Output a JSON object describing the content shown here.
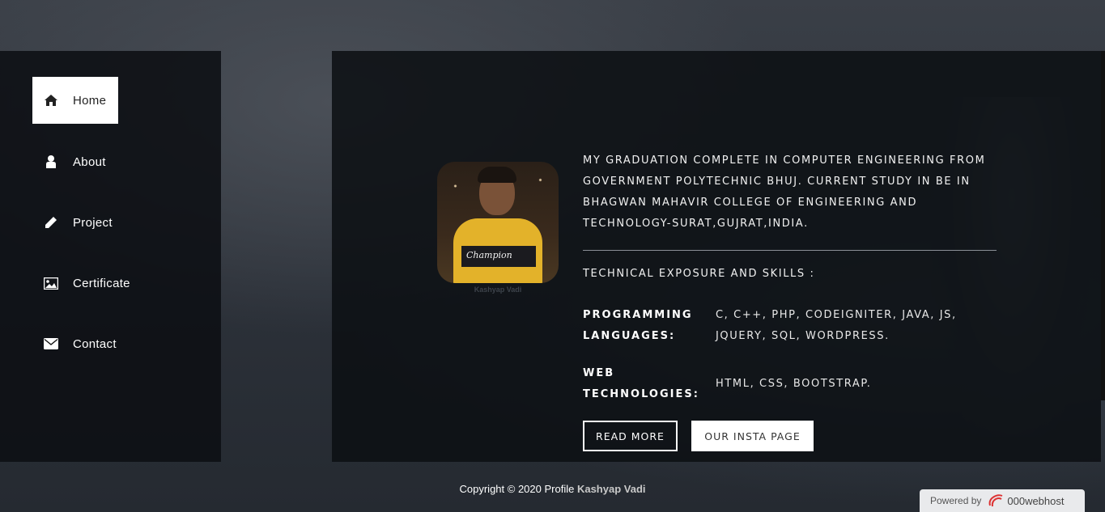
{
  "sidebar": {
    "items": [
      {
        "label": "Home",
        "icon": "home-icon",
        "active": true
      },
      {
        "label": "About",
        "icon": "user-icon",
        "active": false
      },
      {
        "label": "Project",
        "icon": "pencil-icon",
        "active": false
      },
      {
        "label": "Certificate",
        "icon": "image-icon",
        "active": false
      },
      {
        "label": "Contact",
        "icon": "envelope-icon",
        "active": false
      }
    ]
  },
  "profile": {
    "caption": "Kashyap Vadi",
    "shirt_text": "Champion"
  },
  "about": {
    "text": "MY GRADUATION COMPLETE IN COMPUTER ENGINEERING FROM GOVERNMENT POLYTECHNIC BHUJ. CURRENT STUDY IN BE IN BHAGWAN MAHAVIR COLLEGE OF ENGINEERING AND TECHNOLOGY-SURAT,GUJRAT,INDIA.",
    "skills_title": "TECHNICAL EXPOSURE AND SKILLS :",
    "skills": [
      {
        "label": "PROGRAMMING LANGUAGES:",
        "value": "C, C++, PHP, CODEIGNITER, JAVA, JS, JQUERY, SQL, WORDPRESS."
      },
      {
        "label": "WEB TECHNOLOGIES:",
        "value": "HTML, CSS, BOOTSTRAP."
      }
    ]
  },
  "buttons": {
    "read_more": "READ MORE",
    "insta": "OUR INSTA PAGE"
  },
  "footer": {
    "text": "Copyright © 2020 Profile",
    "name": "Kashyap Vadi"
  },
  "powered": {
    "prefix": "Powered by",
    "host": "000webhost"
  }
}
